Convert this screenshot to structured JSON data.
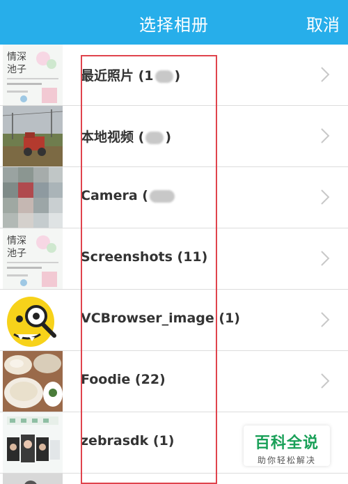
{
  "header": {
    "title": "选择相册",
    "cancel_label": "取消",
    "background": "#27aeea"
  },
  "albums": [
    {
      "name": "最近照片",
      "count_visible": "1",
      "count_blurred": true,
      "label_prefix": "最近照片 (1",
      "label_suffix": ")"
    },
    {
      "name": "本地视频",
      "count_blurred": true,
      "label_prefix": "本地视频 (",
      "label_suffix": ")"
    },
    {
      "name": "Camera",
      "count_blurred": true,
      "label_prefix": "Camera (",
      "label_suffix": ""
    },
    {
      "name": "Screenshots",
      "count": "11",
      "label": "Screenshots (11)"
    },
    {
      "name": "VCBrowser_image",
      "count": "1",
      "label": "VCBrowser_image (1)"
    },
    {
      "name": "Foodie",
      "count": "22",
      "label": "Foodie (22)"
    },
    {
      "name": "zebrasdk",
      "count": "1",
      "label": "zebrasdk (1)"
    }
  ],
  "watermark": {
    "main": "百科全说",
    "sub": "助你轻松解决",
    "color": "#19a058"
  },
  "highlight_color": "#e0434c"
}
